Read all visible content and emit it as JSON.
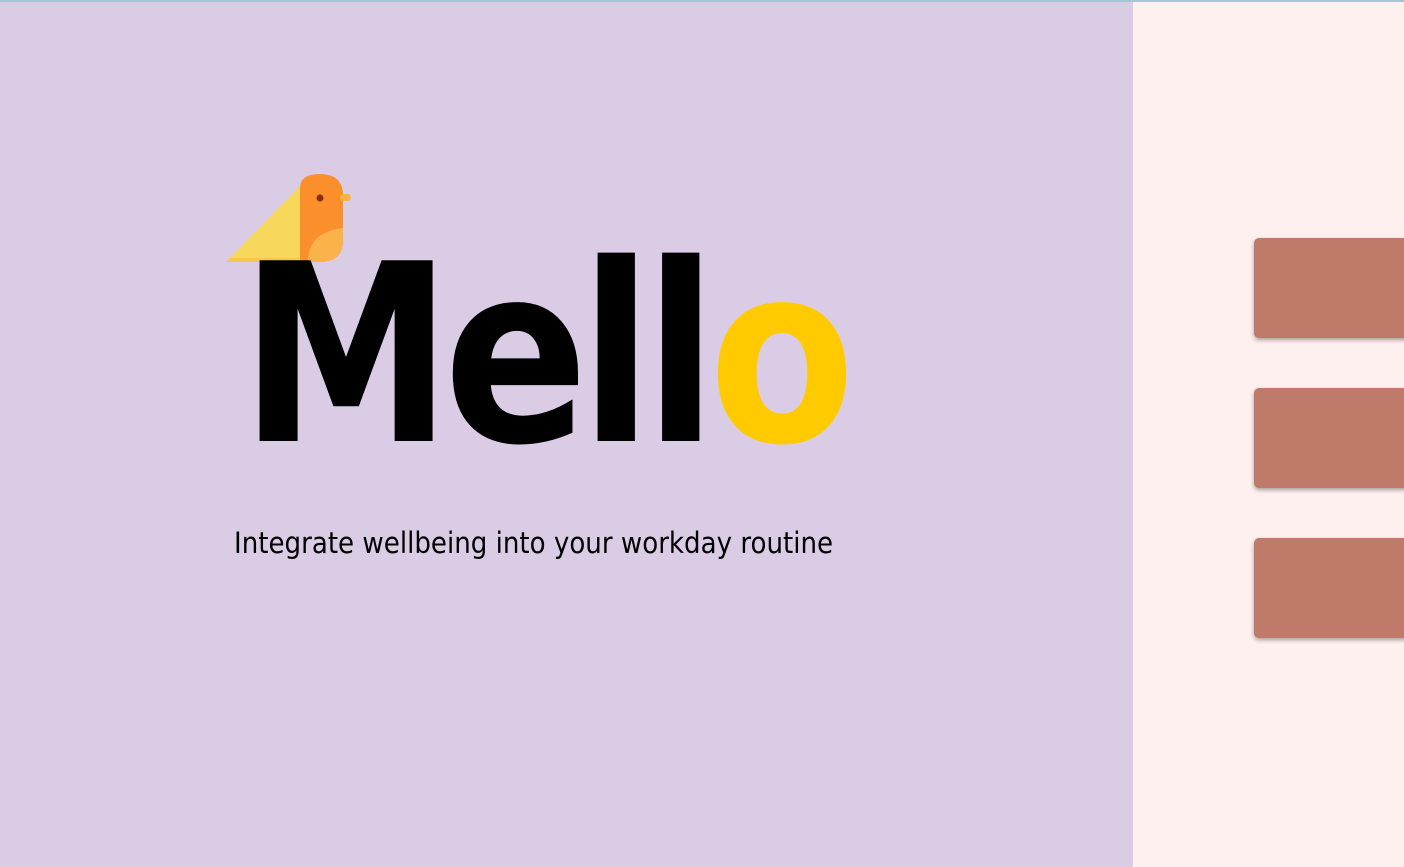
{
  "brand": {
    "logo_main": "Mell",
    "logo_accent": "o",
    "logo_icon": "bird-icon",
    "tagline": "Integrate wellbeing into your workday routine"
  },
  "menu": {
    "items": [
      {
        "label": ""
      },
      {
        "label": ""
      },
      {
        "label": ""
      }
    ]
  },
  "colors": {
    "left_panel_bg": "#dbcce6",
    "right_panel_bg": "#fdf0ef",
    "logo_text": "#000000",
    "logo_accent": "#ffcb00",
    "button_bg": "#c07a69",
    "bird_body": "#fb8f2c",
    "bird_wing": "#f7d85c"
  }
}
